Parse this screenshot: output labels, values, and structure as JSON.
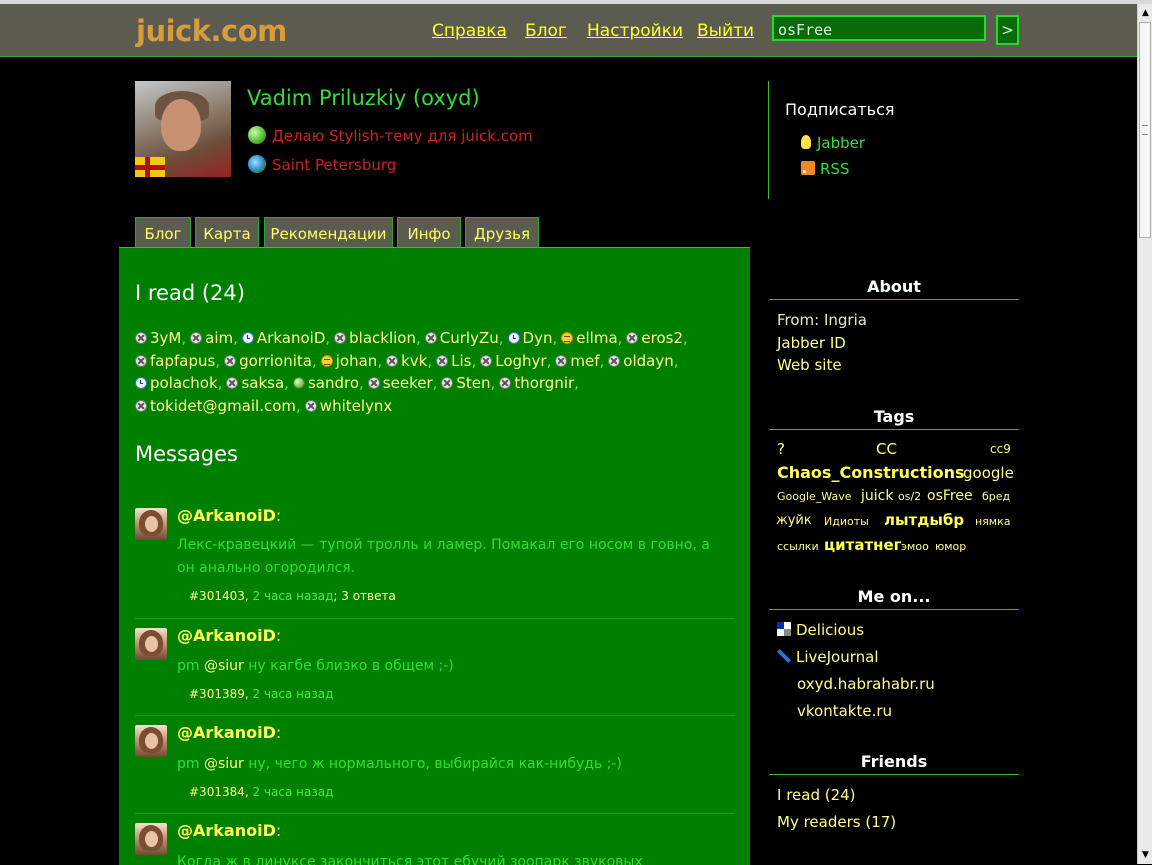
{
  "header": {
    "logo": "juick.com",
    "nav": [
      "Справка",
      "Блог",
      "Настройки",
      "Выйти"
    ],
    "search_value": "osFree",
    "search_button": ">"
  },
  "profile": {
    "name": "Vadim Priluzkiy (oxyd)",
    "status": "Делаю Stylish-тему для juick.com",
    "location": "Saint Petersburg",
    "icons": [
      "status-icon",
      "globe-icon",
      "flag-icon"
    ]
  },
  "subscribe": {
    "title": "Подписаться",
    "jabber": "Jabber",
    "rss": "RSS"
  },
  "tabs": [
    "Блог",
    "Карта",
    "Рекомендации",
    "Инфо",
    "Друзья"
  ],
  "main": {
    "read_title": "I read (24)",
    "messages_title": "Messages",
    "friends": [
      {
        "name": "3yM",
        "icon": "x"
      },
      {
        "name": "aim",
        "icon": "x"
      },
      {
        "name": "ArkanoiD",
        "icon": "clock"
      },
      {
        "name": "blacklion",
        "icon": "x"
      },
      {
        "name": "CurlyZu",
        "icon": "x"
      },
      {
        "name": "Dyn",
        "icon": "clock"
      },
      {
        "name": "ellma",
        "icon": "lines"
      },
      {
        "name": "eros2",
        "icon": "x"
      },
      {
        "name": "fapfapus",
        "icon": "x"
      },
      {
        "name": "gorrionita",
        "icon": "x"
      },
      {
        "name": "johan",
        "icon": "lines"
      },
      {
        "name": "kvk",
        "icon": "x"
      },
      {
        "name": "Lis",
        "icon": "x"
      },
      {
        "name": "Loghyr",
        "icon": "x"
      },
      {
        "name": "mef",
        "icon": "x"
      },
      {
        "name": "oldayn",
        "icon": "x"
      },
      {
        "name": "polachok",
        "icon": "clock"
      },
      {
        "name": "saksa",
        "icon": "x"
      },
      {
        "name": "sandro",
        "icon": "ball"
      },
      {
        "name": "seeker",
        "icon": "x"
      },
      {
        "name": "Sten",
        "icon": "x"
      },
      {
        "name": "thorgnir",
        "icon": "x"
      },
      {
        "name": "tokidet@gmail.com",
        "icon": "x"
      },
      {
        "name": "whitelynx",
        "icon": "x"
      }
    ],
    "messages": [
      {
        "author": "@ArkanoiD",
        "text": "Лекс-кравецкий — тупой тролль и ламер. Помакал его носом в говно, а он анально огородился.",
        "id": "#301403",
        "time": "2 часа назад",
        "replies": "3 ответа"
      },
      {
        "author": "@ArkanoiD",
        "prefix": "pm",
        "mention": "@siur",
        "text": "ну кагбе близко в общем ;-)",
        "id": "#301389",
        "time": "2 часа назад"
      },
      {
        "author": "@ArkanoiD",
        "prefix": "pm",
        "mention": "@siur",
        "text": "ну, чего ж нормального, выбирайся как-нибудь ;-)",
        "id": "#301384",
        "time": "2 часа назад"
      },
      {
        "author": "@ArkanoiD",
        "text": "Когда ж в линуксе закончиться этот ебучий зоопарк звуковых подсистем?"
      }
    ]
  },
  "sidebar": {
    "about": {
      "title": "About",
      "from": "From: Ingria",
      "jabber": "Jabber ID",
      "website": "Web site"
    },
    "tags": {
      "title": "Tags",
      "items": [
        "?",
        "CC",
        "cc9",
        "Chaos_Constructions",
        "google",
        "Google_Wave",
        "juick",
        "os/2",
        "osFree",
        "бред",
        "жуйк",
        "Идиоты",
        "лытдыбр",
        "нямка",
        "ссылки",
        "цитатнег",
        "эмоо",
        "юмор"
      ]
    },
    "me_on": {
      "title": "Me on...",
      "items": [
        "Delicious",
        "LiveJournal",
        "oxyd.habrahabr.ru",
        "vkontakte.ru"
      ]
    },
    "friends": {
      "title": "Friends",
      "items": [
        "I read (24)",
        "My readers (17)"
      ]
    }
  }
}
